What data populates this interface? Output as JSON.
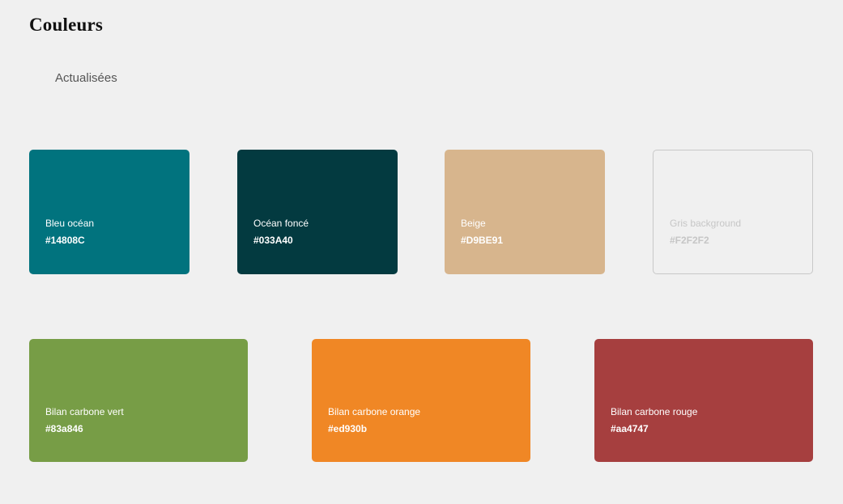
{
  "page": {
    "title": "Couleurs",
    "section_label": "Actualisées"
  },
  "swatches": [
    {
      "name": "Bleu océan",
      "hex_label": "#14808C",
      "color": "#01737E"
    },
    {
      "name": "Océan foncé",
      "hex_label": "#033A40",
      "color": "#033A40"
    },
    {
      "name": "Beige",
      "hex_label": "#D9BE91",
      "color": "#D7B58D"
    },
    {
      "name": "Gris background",
      "hex_label": "#F2F2F2",
      "color": "#F0F0F0"
    },
    {
      "name": "Bilan carbone vert",
      "hex_label": "#83a846",
      "color": "#779D46"
    },
    {
      "name": "Bilan carbone orange",
      "hex_label": "#ed930b",
      "color": "#F08725"
    },
    {
      "name": "Bilan carbone rouge",
      "hex_label": "#aa4747",
      "color": "#A63F3F"
    }
  ]
}
